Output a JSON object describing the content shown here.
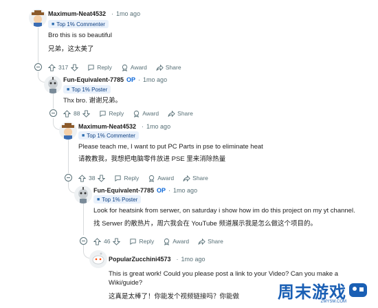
{
  "actions": {
    "reply": "Reply",
    "award": "Award",
    "share": "Share"
  },
  "comments": [
    {
      "username": "Maximum-Neat4532",
      "op": "",
      "dot": "·",
      "time": "1mo ago",
      "flair": "Top 1% Commenter",
      "body": [
        "Bro this is so beautiful",
        "兄弟，这太美了"
      ],
      "votes": "317",
      "avatar": "avatar-cowboy"
    },
    {
      "username": "Fun-Equivalent-7785",
      "op": "OP",
      "dot": "·",
      "time": "1mo ago",
      "flair": "Top 1% Poster",
      "body": [
        "Thx bro.   谢谢兄弟。"
      ],
      "votes": "88",
      "avatar": "avatar-robot"
    },
    {
      "username": "Maximum-Neat4532",
      "op": "",
      "dot": "·",
      "time": "1mo ago",
      "flair": "Top 1% Commenter",
      "body": [
        "Please teach me, I want to put PC Parts in pse to eliminate heat",
        "请教教我，我想把电脑零件放进 PSE 里来消除热量"
      ],
      "votes": "38",
      "avatar": "avatar-cowboy"
    },
    {
      "username": "Fun-Equivalent-7785",
      "op": "OP",
      "dot": "·",
      "time": "1mo ago",
      "flair": "Top 1% Poster",
      "body": [
        "Look for heatsink from serwer, on saturday i show how im do this project on my yt channel.",
        "找 Serwer 的散热片，周六我会在 YouTube 频道展示我是怎么做这个项目的。"
      ],
      "votes": "46",
      "avatar": "avatar-robot"
    },
    {
      "username": "PopularZucchini4573",
      "op": "",
      "dot": "·",
      "time": "1mo ago",
      "flair": "",
      "body": [
        "This is great work! Could you please post a link to your Video? Can you make a",
        "Wiki/guide?",
        "这真是太棒了！你能发个视频链接吗？你能做"
      ],
      "votes": "",
      "avatar": "avatar-snoo"
    }
  ],
  "watermark": {
    "text": "周末游戏",
    "sub": "ZMYSM.COM"
  }
}
